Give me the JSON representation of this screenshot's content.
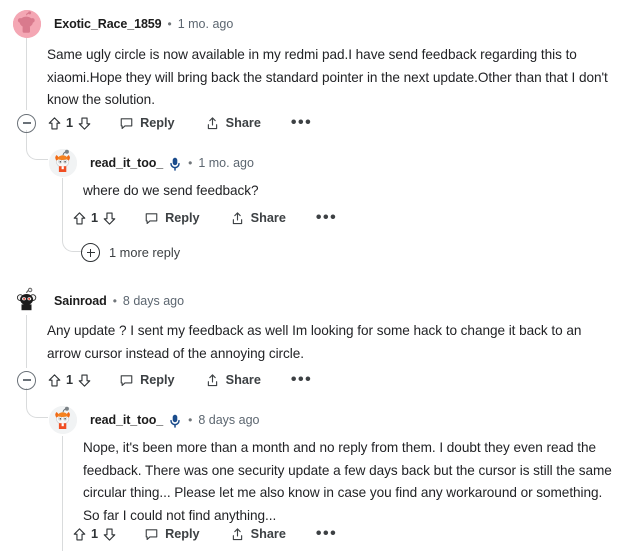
{
  "thread": {
    "comments": [
      {
        "id": "c1",
        "author": "Exotic_Race_1859",
        "separator": "•",
        "timestamp": "1 mo. ago",
        "is_op": false,
        "avatar": "snoo-pink-avatar",
        "body": "Same ugly circle is now available in my redmi pad.I have send feedback regarding this to xiaomi.Hope they will bring back the standard pointer in the next update.Other than that I don't know the solution.",
        "actions": {
          "collapse": "collapse-thread",
          "upvote": "upvote",
          "vote_count": "1",
          "downvote": "downvote",
          "reply_label": "Reply",
          "share_label": "Share",
          "overflow_label": "•••"
        },
        "replies": [
          {
            "id": "c1r1",
            "author": "read_it_too_",
            "separator": "•",
            "timestamp": "1 mo. ago",
            "is_op": true,
            "badge": "microphone-icon",
            "avatar": "snoo-orange-avatar",
            "body": "where do we send feedback?",
            "actions": {
              "upvote": "upvote",
              "vote_count": "1",
              "downvote": "downvote",
              "reply_label": "Reply",
              "share_label": "Share",
              "overflow_label": "•••"
            },
            "more_replies_label": "1 more reply"
          }
        ]
      },
      {
        "id": "c2",
        "author": "Sainroad",
        "separator": "•",
        "timestamp": "8 days ago",
        "is_op": false,
        "avatar": "snoo-black-avatar",
        "body": "Any update ? I sent my feedback as well Im looking for some hack to change it back to an arrow cursor instead of the annoying circle.",
        "actions": {
          "collapse": "collapse-thread",
          "upvote": "upvote",
          "vote_count": "1",
          "downvote": "downvote",
          "reply_label": "Reply",
          "share_label": "Share",
          "overflow_label": "•••"
        },
        "replies": [
          {
            "id": "c2r1",
            "author": "read_it_too_",
            "separator": "•",
            "timestamp": "8 days ago",
            "is_op": true,
            "badge": "microphone-icon",
            "avatar": "snoo-orange-avatar",
            "body": "Nope, it's been more than a month and no reply from them. I doubt they even read the feedback. There was one security update a few days back but the cursor is still the same circular thing... Please let me also know in case you find any workaround or something. So far I could not find anything...",
            "actions": {
              "upvote": "upvote",
              "vote_count": "1",
              "downvote": "downvote",
              "reply_label": "Reply",
              "share_label": "Share",
              "overflow_label": "•••"
            }
          }
        ]
      }
    ]
  },
  "colors": {
    "background": "#ffffff",
    "text_primary": "#222326",
    "text_meta": "#5c6670",
    "action_text": "#3d4144",
    "thread_line": "#d9dbdc",
    "op_badge": "#1b4c8c",
    "avatar_pink": "#f2a2b0",
    "avatar_orange": "#f06a17",
    "avatar_black": "#1b1b1b"
  }
}
